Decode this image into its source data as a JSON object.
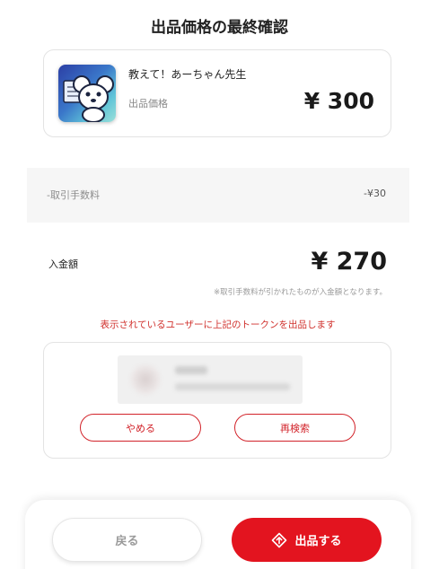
{
  "page": {
    "title": "出品価格の最終確認"
  },
  "item": {
    "name": "教えて！あーちゃん先生",
    "price_label": "出品価格",
    "price": "¥ 300"
  },
  "fee": {
    "label": "-取引手数料",
    "value": "-¥30"
  },
  "deposit": {
    "label": "入金額",
    "value": "¥ 270",
    "note": "※取引手数料が引かれたものが入金額となります。"
  },
  "listing_message": "表示されているユーザーに上記のトークンを出品します",
  "user_card": {
    "cancel_label": "やめる",
    "research_label": "再検索"
  },
  "footer": {
    "back_label": "戻る",
    "list_label": "出品する"
  },
  "colors": {
    "accent": "#e3141f",
    "warning_text": "#d0312d"
  },
  "icons": {
    "list_button": "upload-diamond-icon"
  }
}
